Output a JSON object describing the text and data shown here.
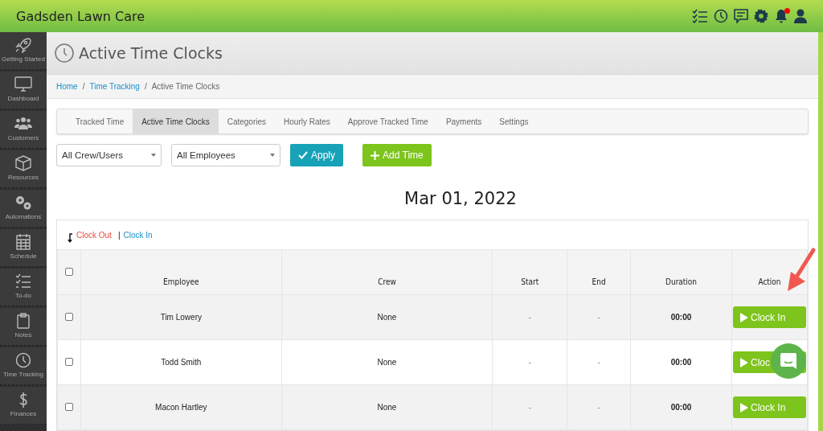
{
  "app": {
    "title": "Gadsden Lawn Care",
    "notification_dot": true
  },
  "sidebar": {
    "items": [
      {
        "label": "Getting Started",
        "kind": "rocket"
      },
      {
        "label": "Dashboard",
        "kind": "monitor"
      },
      {
        "label": "Customers",
        "kind": "users"
      },
      {
        "label": "Resources",
        "kind": "cube"
      },
      {
        "label": "Automations",
        "kind": "gears"
      },
      {
        "label": "Schedule",
        "kind": "calendar"
      },
      {
        "label": "To-do",
        "kind": "checklist"
      },
      {
        "label": "Notes",
        "kind": "clipboard"
      },
      {
        "label": "Time Tracking",
        "kind": "clock"
      },
      {
        "label": "Finances",
        "kind": "dollar"
      }
    ]
  },
  "page": {
    "title": "Active Time Clocks"
  },
  "breadcrumb": [
    {
      "label": "Home",
      "kind": "link"
    },
    {
      "label": "/",
      "kind": "separator"
    },
    {
      "label": "Time Tracking",
      "kind": "link"
    },
    {
      "label": "/",
      "kind": "separator"
    },
    {
      "label": "Active Time Clocks",
      "kind": "current"
    }
  ],
  "tabs": [
    {
      "label": "Tracked Time",
      "selected": false
    },
    {
      "label": "Active Time Clocks",
      "selected": true
    },
    {
      "label": "Categories",
      "selected": false
    },
    {
      "label": "Hourly Rates",
      "selected": false
    },
    {
      "label": "Approve Tracked Time",
      "selected": false
    },
    {
      "label": "Payments",
      "selected": false
    },
    {
      "label": "Settings",
      "selected": false
    }
  ],
  "filters": {
    "crew": "All Crew/Users",
    "employees": "All Employees",
    "apply": "Apply",
    "add": "Add Time"
  },
  "date": "Mar 01, 2022",
  "bulk_actions": {
    "clock_out": "Clock Out",
    "separator": "|",
    "clock_in": "Clock In"
  },
  "table": {
    "columns": [
      "Employee",
      "Crew",
      "Start",
      "End",
      "Duration",
      "Action"
    ],
    "header_checked": false,
    "rows": [
      {
        "checked": false,
        "employee": "Tim Lowery",
        "crew": "None",
        "start": "-",
        "end": "-",
        "duration": "00:00",
        "action": "Clock In"
      },
      {
        "checked": false,
        "employee": "Todd Smith",
        "crew": "None",
        "start": "-",
        "end": "-",
        "duration": "00:00",
        "action": "Cloc"
      },
      {
        "checked": false,
        "employee": "Macon Hartley",
        "crew": "None",
        "start": "-",
        "end": "-",
        "duration": "00:00",
        "action": "Clock In"
      }
    ]
  }
}
